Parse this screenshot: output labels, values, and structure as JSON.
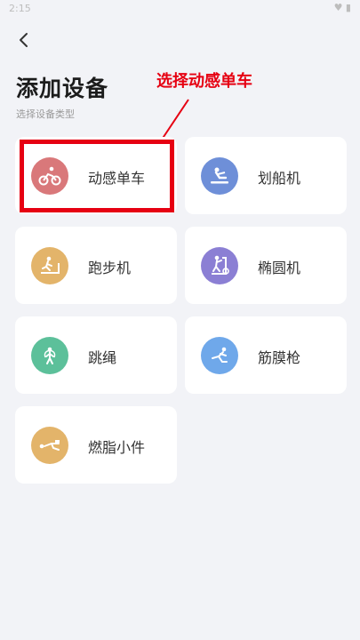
{
  "status_bar": {
    "time": "2:15",
    "icons": "♥ ▮"
  },
  "header": {
    "title": "添加设备",
    "subtitle": "选择设备类型"
  },
  "annotation": {
    "text": "选择动感单车",
    "color": "#e60012"
  },
  "devices": [
    {
      "label": "动感单车",
      "icon": "bike-icon",
      "color": "#d9787a"
    },
    {
      "label": "划船机",
      "icon": "rowing-icon",
      "color": "#6e8fd8"
    },
    {
      "label": "跑步机",
      "icon": "treadmill-icon",
      "color": "#e3b46a"
    },
    {
      "label": "椭圆机",
      "icon": "elliptical-icon",
      "color": "#8b7fd4"
    },
    {
      "label": "跳绳",
      "icon": "jump-rope-icon",
      "color": "#5cc09a"
    },
    {
      "label": "筋膜枪",
      "icon": "massage-gun-icon",
      "color": "#6fa8ea"
    },
    {
      "label": "燃脂小件",
      "icon": "fat-burning-icon",
      "color": "#e3b46a"
    }
  ]
}
